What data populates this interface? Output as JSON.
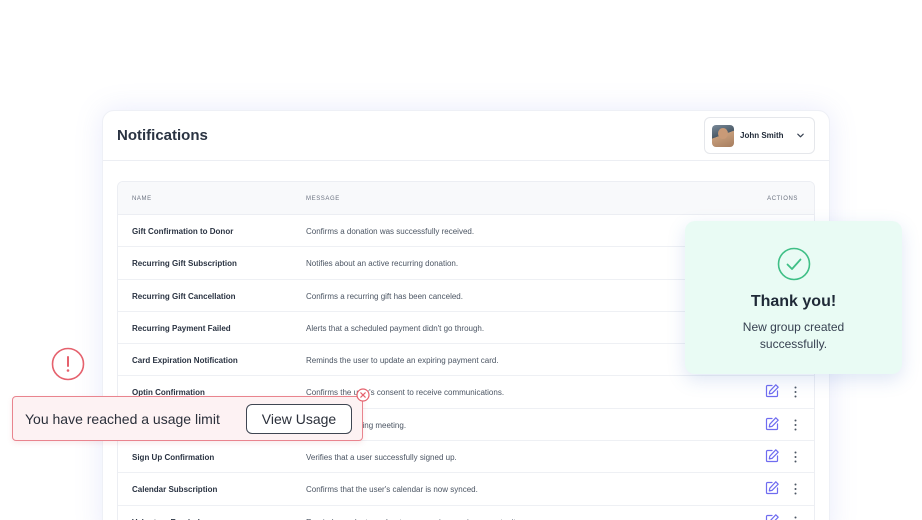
{
  "panel": {
    "title": "Notifications",
    "user": {
      "name": "John Smith"
    }
  },
  "table": {
    "headers": {
      "name": "NAME",
      "message": "MESSAGE",
      "actions": "ACTIONS"
    },
    "rows": [
      {
        "name": "Gift Confirmation to Donor",
        "message": "Confirms a donation was successfully received."
      },
      {
        "name": "Recurring Gift Subscription",
        "message": "Notifies about an active recurring donation."
      },
      {
        "name": "Recurring Gift Cancellation",
        "message": "Confirms a recurring gift has been canceled."
      },
      {
        "name": "Recurring Payment Failed",
        "message": "Alerts that a scheduled payment didn't go through."
      },
      {
        "name": "Card Expiration Notification",
        "message": "Reminds the user to update an expiring payment card."
      },
      {
        "name": "Optin Confirmation",
        "message": "Confirms the user's consent to receive communications."
      },
      {
        "name": "",
        "message": "ils for an upcoming meeting."
      },
      {
        "name": "Sign Up Confirmation",
        "message": "Verifies that a user successfully signed up."
      },
      {
        "name": "Calendar Subscription",
        "message": "Confirms that the user's calendar is now synced."
      },
      {
        "name": "Volunteer Reminder",
        "message": "Reminds a volunteer about an upcoming serving opportunity."
      }
    ]
  },
  "success_toast": {
    "title": "Thank you!",
    "message": "New group created successfully."
  },
  "usage_banner": {
    "message": "You have reached a usage limit",
    "button_label": "View Usage"
  },
  "colors": {
    "success_bg": "#e9fbf4",
    "success_accent": "#3fbf86",
    "warning_accent": "#e5616d",
    "icon_accent": "#6f6cf0"
  },
  "icons": {
    "user_menu": "chevron-down-icon",
    "row_edit": "edit-icon",
    "row_more": "more-vertical-icon",
    "toast": "check-circle-icon",
    "warning": "exclamation-circle-icon",
    "banner_close": "close-icon"
  }
}
